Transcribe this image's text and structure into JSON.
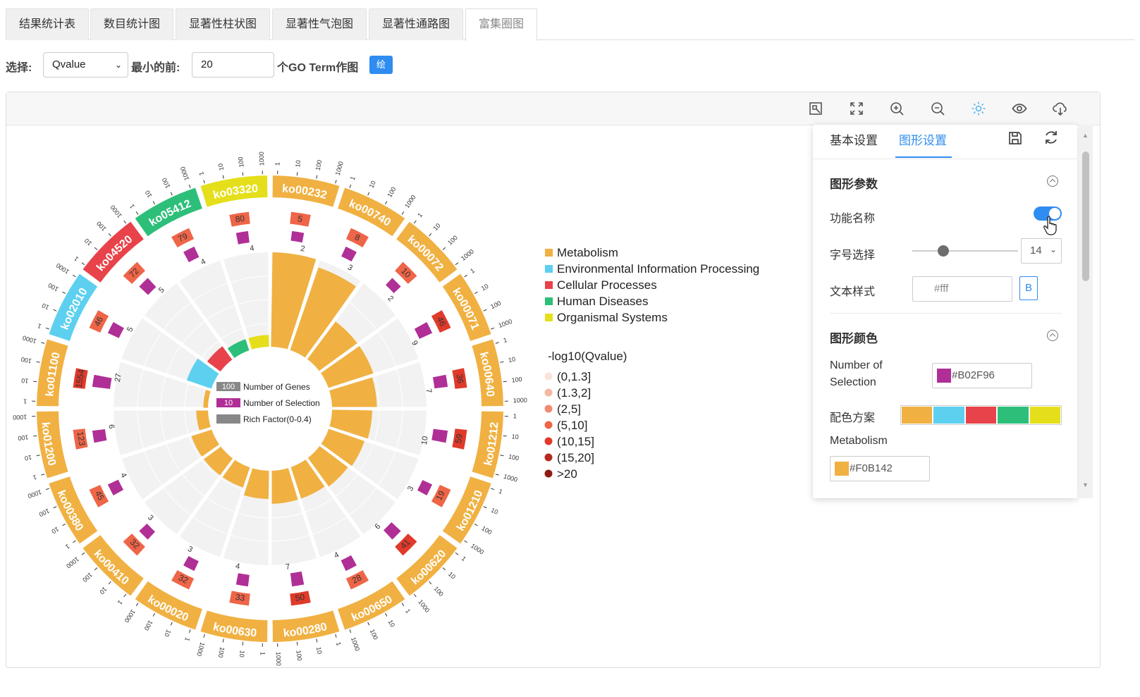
{
  "tabs": [
    {
      "label": "结果统计表",
      "active": false
    },
    {
      "label": "数目统计图",
      "active": false
    },
    {
      "label": "显著性柱状图",
      "active": false
    },
    {
      "label": "显著性气泡图",
      "active": false
    },
    {
      "label": "显著性通路图",
      "active": false
    },
    {
      "label": "富集圈图",
      "active": true
    }
  ],
  "toolbar": {
    "select_label": "选择:",
    "select_value": "Qvalue",
    "top_label": "最小的前:",
    "top_value": "20",
    "suffix_label": "个GO Term作图",
    "draw_button": "绘图"
  },
  "panel_icons": [
    "restore-icon",
    "fullscreen-icon",
    "zoom-in-icon",
    "zoom-out-icon",
    "settings-gear-icon",
    "eye-icon",
    "cloud-download-icon"
  ],
  "settings": {
    "tab_basic": "基本设置",
    "tab_graph": "图形设置",
    "section_params": "图形参数",
    "func_name_label": "功能名称",
    "func_name_on": true,
    "font_label": "字号选择",
    "font_size": "14",
    "font_slider_fraction": 0.29,
    "text_style_label": "文本样式",
    "text_style_placeholder": "#fff",
    "bold_button": "B",
    "section_colors": "图形颜色",
    "selection_label_1": "Number of",
    "selection_label_2": "Selection",
    "selection_color": "#B02F96",
    "scheme_label": "配色方案",
    "scheme_colors": [
      "#F0B142",
      "#5DD0F0",
      "#E8424A",
      "#2DBF7A",
      "#E5DF1B"
    ],
    "metabolism_label": "Metabolism",
    "metabolism_color": "#F0B142"
  },
  "chart_data": {
    "type": "circos",
    "categories": {
      "Metabolism": "#F0B142",
      "Environmental Information Processing": "#5DD0F0",
      "Cellular Processes": "#E8424A",
      "Human Diseases": "#2DBF7A",
      "Organismal Systems": "#E5DF1B"
    },
    "terms": [
      {
        "id": "ko00232",
        "cat": "Metabolism",
        "genes": 5,
        "selection": 2,
        "rich": 0.4,
        "qbin": 3
      },
      {
        "id": "ko00740",
        "cat": "Metabolism",
        "genes": 8,
        "selection": 3,
        "rich": 0.37,
        "qbin": 3
      },
      {
        "id": "ko00072",
        "cat": "Metabolism",
        "genes": 10,
        "selection": 2,
        "rich": 0.2,
        "qbin": 3
      },
      {
        "id": "ko00071",
        "cat": "Metabolism",
        "genes": 46,
        "selection": 9,
        "rich": 0.2,
        "qbin": 4
      },
      {
        "id": "ko00640",
        "cat": "Metabolism",
        "genes": 36,
        "selection": 7,
        "rich": 0.19,
        "qbin": 4
      },
      {
        "id": "ko01212",
        "cat": "Metabolism",
        "genes": 59,
        "selection": 10,
        "rich": 0.17,
        "qbin": 4
      },
      {
        "id": "ko01210",
        "cat": "Metabolism",
        "genes": 19,
        "selection": 3,
        "rich": 0.16,
        "qbin": 3
      },
      {
        "id": "ko00620",
        "cat": "Metabolism",
        "genes": 41,
        "selection": 6,
        "rich": 0.15,
        "qbin": 4
      },
      {
        "id": "ko00650",
        "cat": "Metabolism",
        "genes": 28,
        "selection": 4,
        "rich": 0.14,
        "qbin": 3
      },
      {
        "id": "ko00280",
        "cat": "Metabolism",
        "genes": 50,
        "selection": 7,
        "rich": 0.14,
        "qbin": 4
      },
      {
        "id": "ko00630",
        "cat": "Metabolism",
        "genes": 33,
        "selection": 4,
        "rich": 0.12,
        "qbin": 3
      },
      {
        "id": "ko00020",
        "cat": "Metabolism",
        "genes": 32,
        "selection": 3,
        "rich": 0.09,
        "qbin": 3
      },
      {
        "id": "ko00410",
        "cat": "Metabolism",
        "genes": 32,
        "selection": 3,
        "rich": 0.09,
        "qbin": 3
      },
      {
        "id": "ko00380",
        "cat": "Metabolism",
        "genes": 45,
        "selection": 4,
        "rich": 0.09,
        "qbin": 3
      },
      {
        "id": "ko01200",
        "cat": "Metabolism",
        "genes": 123,
        "selection": 6,
        "rich": 0.05,
        "qbin": 3
      },
      {
        "id": "ko01100",
        "cat": "Metabolism",
        "genes": 1554,
        "selection": 27,
        "rich": 0.02,
        "qbin": 4
      },
      {
        "id": "ko02010",
        "cat": "Environmental Information Processing",
        "genes": 46,
        "selection": 5,
        "rich": 0.11,
        "qbin": 3
      },
      {
        "id": "ko04520",
        "cat": "Cellular Processes",
        "genes": 72,
        "selection": 5,
        "rich": 0.07,
        "qbin": 3
      },
      {
        "id": "ko05412",
        "cat": "Human Diseases",
        "genes": 79,
        "selection": 4,
        "rich": 0.05,
        "qbin": 3
      },
      {
        "id": "ko03320",
        "cat": "Organismal Systems",
        "genes": 80,
        "selection": 4,
        "rich": 0.05,
        "qbin": 3
      }
    ],
    "scale_ticks": [
      "1",
      "10",
      "100",
      "1000"
    ],
    "center_legend": [
      {
        "box": "100",
        "label": "Number of Genes",
        "color": "#888888"
      },
      {
        "box": "10",
        "label": "Number of Selection",
        "color": "#B02F96"
      },
      {
        "box": "",
        "label": "Rich Factor(0-0.4)",
        "color": "#888888"
      }
    ],
    "qvalue_title": "-log10(Qvalue)",
    "qvalue_bins": [
      {
        "label": "(0,1.3]",
        "color": "#FBE3D9"
      },
      {
        "label": "(1.3,2]",
        "color": "#F5B7A0"
      },
      {
        "label": "(2,5]",
        "color": "#F08A70"
      },
      {
        "label": "(5,10]",
        "color": "#EE6548"
      },
      {
        "label": "(10,15]",
        "color": "#E03A2A"
      },
      {
        "label": "(15,20]",
        "color": "#B52A1E"
      },
      {
        "label": ">20",
        "color": "#8E1A12"
      }
    ]
  }
}
